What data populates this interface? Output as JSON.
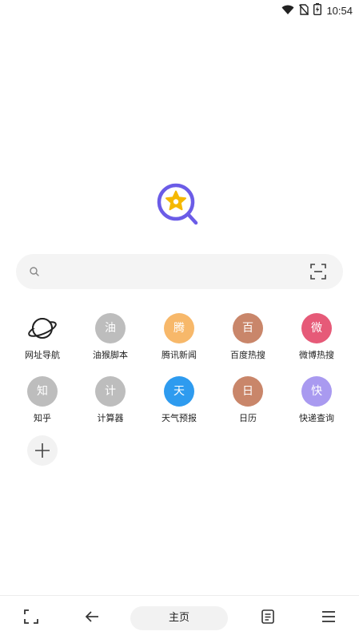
{
  "status_bar": {
    "time": "10:54",
    "icons": [
      "wifi-icon",
      "no-sim-icon",
      "battery-charging-icon"
    ]
  },
  "logo": {
    "icon": "star-search-logo-icon",
    "ring_color": "#6b5ce7",
    "star_color": "#f5b800"
  },
  "search": {
    "value": "",
    "placeholder": "",
    "icon": "search-icon",
    "scan_icon": "scan-icon"
  },
  "shortcuts": [
    {
      "glyph": "",
      "label": "网址导航",
      "icon": "planet-icon",
      "color": ""
    },
    {
      "glyph": "油",
      "label": "油猴脚本",
      "color": "#bdbdbd"
    },
    {
      "glyph": "腾",
      "label": "腾讯新闻",
      "color": "#f7b86a"
    },
    {
      "glyph": "百",
      "label": "百度热搜",
      "color": "#c9866a"
    },
    {
      "glyph": "微",
      "label": "微博热搜",
      "color": "#e65a78"
    },
    {
      "glyph": "知",
      "label": "知乎",
      "color": "#bdbdbd"
    },
    {
      "glyph": "计",
      "label": "计算器",
      "color": "#bdbdbd"
    },
    {
      "glyph": "天",
      "label": "天气预报",
      "color": "#2e9bef"
    },
    {
      "glyph": "日",
      "label": "日历",
      "color": "#c9866a"
    },
    {
      "glyph": "快",
      "label": "快递查询",
      "color": "#a99af0"
    }
  ],
  "add_shortcut": {
    "icon": "plus-icon"
  },
  "bottom_nav": {
    "home_label": "主页",
    "icons": [
      "fullscreen-icon",
      "back-arrow-icon",
      "reader-icon",
      "menu-icon"
    ]
  }
}
